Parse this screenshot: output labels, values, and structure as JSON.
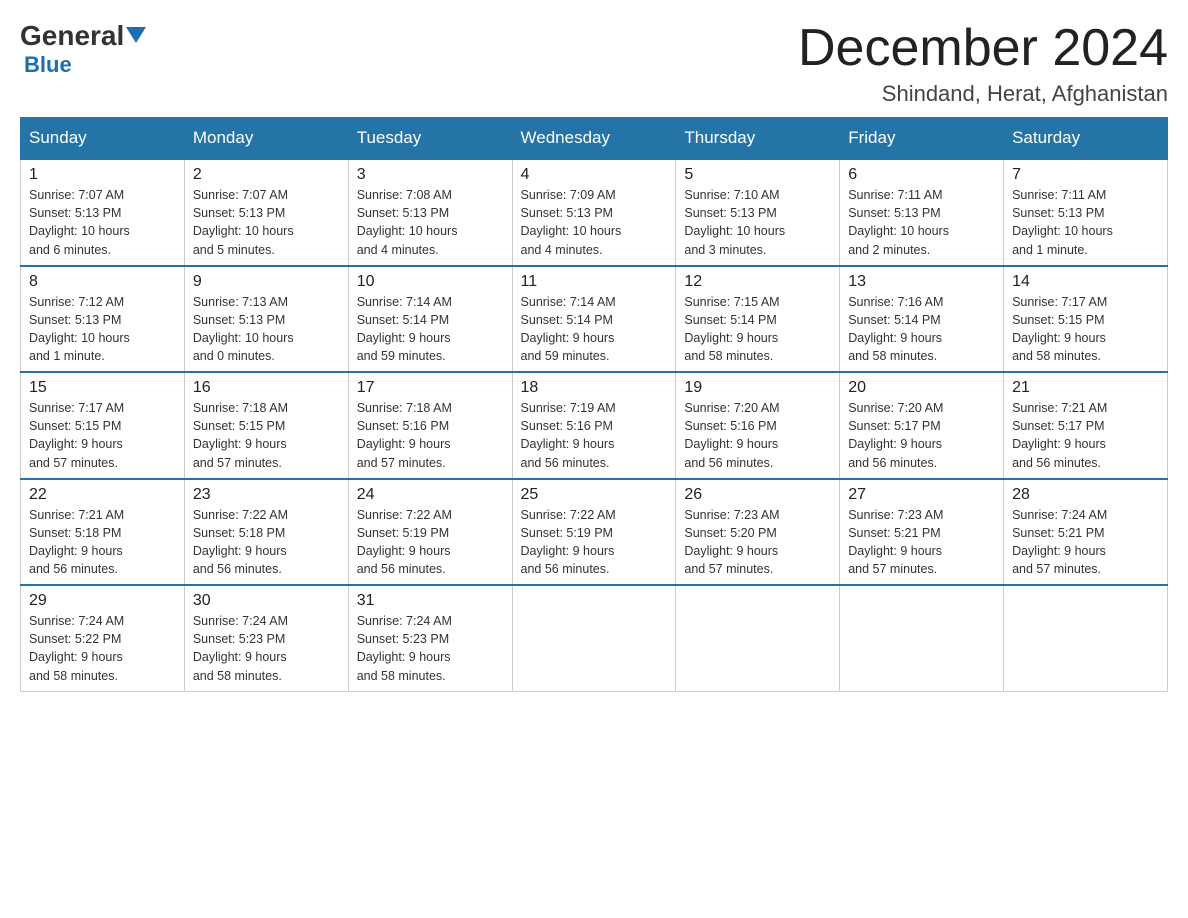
{
  "logo": {
    "general": "General",
    "blue": "Blue"
  },
  "title": "December 2024",
  "location": "Shindand, Herat, Afghanistan",
  "days_of_week": [
    "Sunday",
    "Monday",
    "Tuesday",
    "Wednesday",
    "Thursday",
    "Friday",
    "Saturday"
  ],
  "weeks": [
    [
      {
        "day": "1",
        "info": "Sunrise: 7:07 AM\nSunset: 5:13 PM\nDaylight: 10 hours\nand 6 minutes."
      },
      {
        "day": "2",
        "info": "Sunrise: 7:07 AM\nSunset: 5:13 PM\nDaylight: 10 hours\nand 5 minutes."
      },
      {
        "day": "3",
        "info": "Sunrise: 7:08 AM\nSunset: 5:13 PM\nDaylight: 10 hours\nand 4 minutes."
      },
      {
        "day": "4",
        "info": "Sunrise: 7:09 AM\nSunset: 5:13 PM\nDaylight: 10 hours\nand 4 minutes."
      },
      {
        "day": "5",
        "info": "Sunrise: 7:10 AM\nSunset: 5:13 PM\nDaylight: 10 hours\nand 3 minutes."
      },
      {
        "day": "6",
        "info": "Sunrise: 7:11 AM\nSunset: 5:13 PM\nDaylight: 10 hours\nand 2 minutes."
      },
      {
        "day": "7",
        "info": "Sunrise: 7:11 AM\nSunset: 5:13 PM\nDaylight: 10 hours\nand 1 minute."
      }
    ],
    [
      {
        "day": "8",
        "info": "Sunrise: 7:12 AM\nSunset: 5:13 PM\nDaylight: 10 hours\nand 1 minute."
      },
      {
        "day": "9",
        "info": "Sunrise: 7:13 AM\nSunset: 5:13 PM\nDaylight: 10 hours\nand 0 minutes."
      },
      {
        "day": "10",
        "info": "Sunrise: 7:14 AM\nSunset: 5:14 PM\nDaylight: 9 hours\nand 59 minutes."
      },
      {
        "day": "11",
        "info": "Sunrise: 7:14 AM\nSunset: 5:14 PM\nDaylight: 9 hours\nand 59 minutes."
      },
      {
        "day": "12",
        "info": "Sunrise: 7:15 AM\nSunset: 5:14 PM\nDaylight: 9 hours\nand 58 minutes."
      },
      {
        "day": "13",
        "info": "Sunrise: 7:16 AM\nSunset: 5:14 PM\nDaylight: 9 hours\nand 58 minutes."
      },
      {
        "day": "14",
        "info": "Sunrise: 7:17 AM\nSunset: 5:15 PM\nDaylight: 9 hours\nand 58 minutes."
      }
    ],
    [
      {
        "day": "15",
        "info": "Sunrise: 7:17 AM\nSunset: 5:15 PM\nDaylight: 9 hours\nand 57 minutes."
      },
      {
        "day": "16",
        "info": "Sunrise: 7:18 AM\nSunset: 5:15 PM\nDaylight: 9 hours\nand 57 minutes."
      },
      {
        "day": "17",
        "info": "Sunrise: 7:18 AM\nSunset: 5:16 PM\nDaylight: 9 hours\nand 57 minutes."
      },
      {
        "day": "18",
        "info": "Sunrise: 7:19 AM\nSunset: 5:16 PM\nDaylight: 9 hours\nand 56 minutes."
      },
      {
        "day": "19",
        "info": "Sunrise: 7:20 AM\nSunset: 5:16 PM\nDaylight: 9 hours\nand 56 minutes."
      },
      {
        "day": "20",
        "info": "Sunrise: 7:20 AM\nSunset: 5:17 PM\nDaylight: 9 hours\nand 56 minutes."
      },
      {
        "day": "21",
        "info": "Sunrise: 7:21 AM\nSunset: 5:17 PM\nDaylight: 9 hours\nand 56 minutes."
      }
    ],
    [
      {
        "day": "22",
        "info": "Sunrise: 7:21 AM\nSunset: 5:18 PM\nDaylight: 9 hours\nand 56 minutes."
      },
      {
        "day": "23",
        "info": "Sunrise: 7:22 AM\nSunset: 5:18 PM\nDaylight: 9 hours\nand 56 minutes."
      },
      {
        "day": "24",
        "info": "Sunrise: 7:22 AM\nSunset: 5:19 PM\nDaylight: 9 hours\nand 56 minutes."
      },
      {
        "day": "25",
        "info": "Sunrise: 7:22 AM\nSunset: 5:19 PM\nDaylight: 9 hours\nand 56 minutes."
      },
      {
        "day": "26",
        "info": "Sunrise: 7:23 AM\nSunset: 5:20 PM\nDaylight: 9 hours\nand 57 minutes."
      },
      {
        "day": "27",
        "info": "Sunrise: 7:23 AM\nSunset: 5:21 PM\nDaylight: 9 hours\nand 57 minutes."
      },
      {
        "day": "28",
        "info": "Sunrise: 7:24 AM\nSunset: 5:21 PM\nDaylight: 9 hours\nand 57 minutes."
      }
    ],
    [
      {
        "day": "29",
        "info": "Sunrise: 7:24 AM\nSunset: 5:22 PM\nDaylight: 9 hours\nand 58 minutes."
      },
      {
        "day": "30",
        "info": "Sunrise: 7:24 AM\nSunset: 5:23 PM\nDaylight: 9 hours\nand 58 minutes."
      },
      {
        "day": "31",
        "info": "Sunrise: 7:24 AM\nSunset: 5:23 PM\nDaylight: 9 hours\nand 58 minutes."
      },
      null,
      null,
      null,
      null
    ]
  ]
}
